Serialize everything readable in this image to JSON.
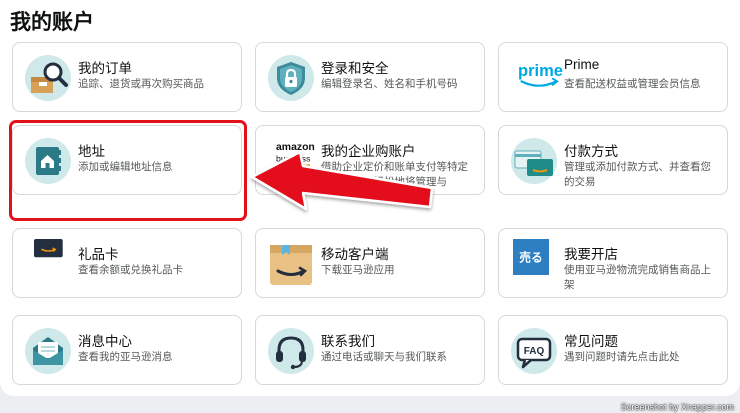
{
  "page": {
    "title": "我的账户"
  },
  "cards": [
    {
      "id": "orders",
      "title": "我的订单",
      "desc": "追踪、退货或再次购买商品",
      "icon": "package-search-icon"
    },
    {
      "id": "security",
      "title": "登录和安全",
      "desc": "编辑登录名、姓名和手机号码",
      "icon": "lock-shield-icon"
    },
    {
      "id": "prime",
      "title": "Prime",
      "desc": "查看配送权益或管理会员信息",
      "icon": "prime-logo-icon",
      "logo_text": "prime"
    },
    {
      "id": "address",
      "title": "地址",
      "desc": "添加或编辑地址信息",
      "icon": "address-book-icon"
    },
    {
      "id": "business",
      "title": "我的企业购账户",
      "desc": "借助企业定价和账单支付等特定功能，可以轻松地将管理与",
      "icon": "amazon-business-logo-icon",
      "logo_line1": "amazon",
      "logo_line2": "business"
    },
    {
      "id": "payments",
      "title": "付款方式",
      "desc": "管理或添加付款方式、并查看您的交易",
      "icon": "credit-cards-icon"
    },
    {
      "id": "giftcards",
      "title": "礼品卡",
      "desc": "查看余额或兑换礼品卡",
      "icon": "gift-card-icon"
    },
    {
      "id": "mobile",
      "title": "移动客户端",
      "desc": "下载亚马逊应用",
      "icon": "amazon-app-icon"
    },
    {
      "id": "sell",
      "title": "我要开店",
      "desc": "使用亚马逊物流完成销售商品上架",
      "icon": "sell-badge-icon",
      "badge_text": "売る"
    },
    {
      "id": "messages",
      "title": "消息中心",
      "desc": "查看我的亚马逊消息",
      "icon": "envelope-icon"
    },
    {
      "id": "contact",
      "title": "联系我们",
      "desc": "通过电话或聊天与我们联系",
      "icon": "headset-icon"
    },
    {
      "id": "faq",
      "title": "常见问题",
      "desc": "遇到问题时请先点击此处",
      "icon": "faq-bubble-icon",
      "badge_text": "FAQ"
    }
  ],
  "annotation": {
    "highlight_color": "#e3101a",
    "target": "address"
  },
  "watermark": "Screenshot by Xnapper.com"
}
